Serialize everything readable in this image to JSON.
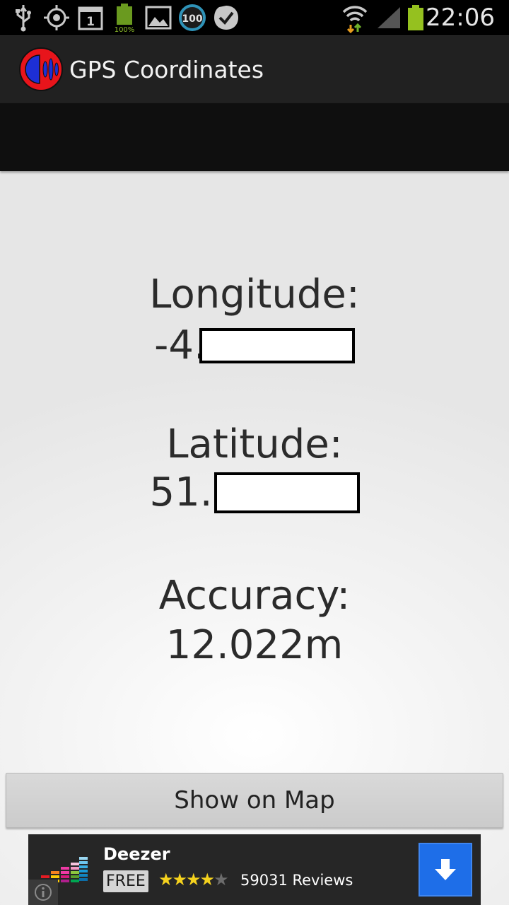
{
  "status_bar": {
    "time": "22:06",
    "calendar_day": "1",
    "battery_small_label": "100%",
    "badge_value": "100",
    "icons": [
      "usb-icon",
      "gps-icon",
      "calendar-icon",
      "battery-full-icon",
      "image-icon",
      "badge-100-icon",
      "check-icon",
      "wifi-icon",
      "signal-icon",
      "battery-icon"
    ]
  },
  "app_bar": {
    "title": "GPS Coordinates"
  },
  "coordinates": {
    "longitude_label": "Longitude:",
    "longitude_prefix": "-4.",
    "latitude_label": "Latitude:",
    "latitude_prefix": "51.",
    "accuracy_label": "Accuracy:",
    "accuracy_value": "12.022m"
  },
  "actions": {
    "show_on_map": "Show on Map"
  },
  "ad": {
    "app_name": "Deezer",
    "price": "FREE",
    "rating_stars": 4,
    "rating_max": 5,
    "reviews": "59031 Reviews"
  },
  "colors": {
    "accent_download": "#1e6ee8",
    "star": "#f5d21e",
    "logo_red": "#e8141b",
    "logo_blue": "#1d2fd6"
  }
}
